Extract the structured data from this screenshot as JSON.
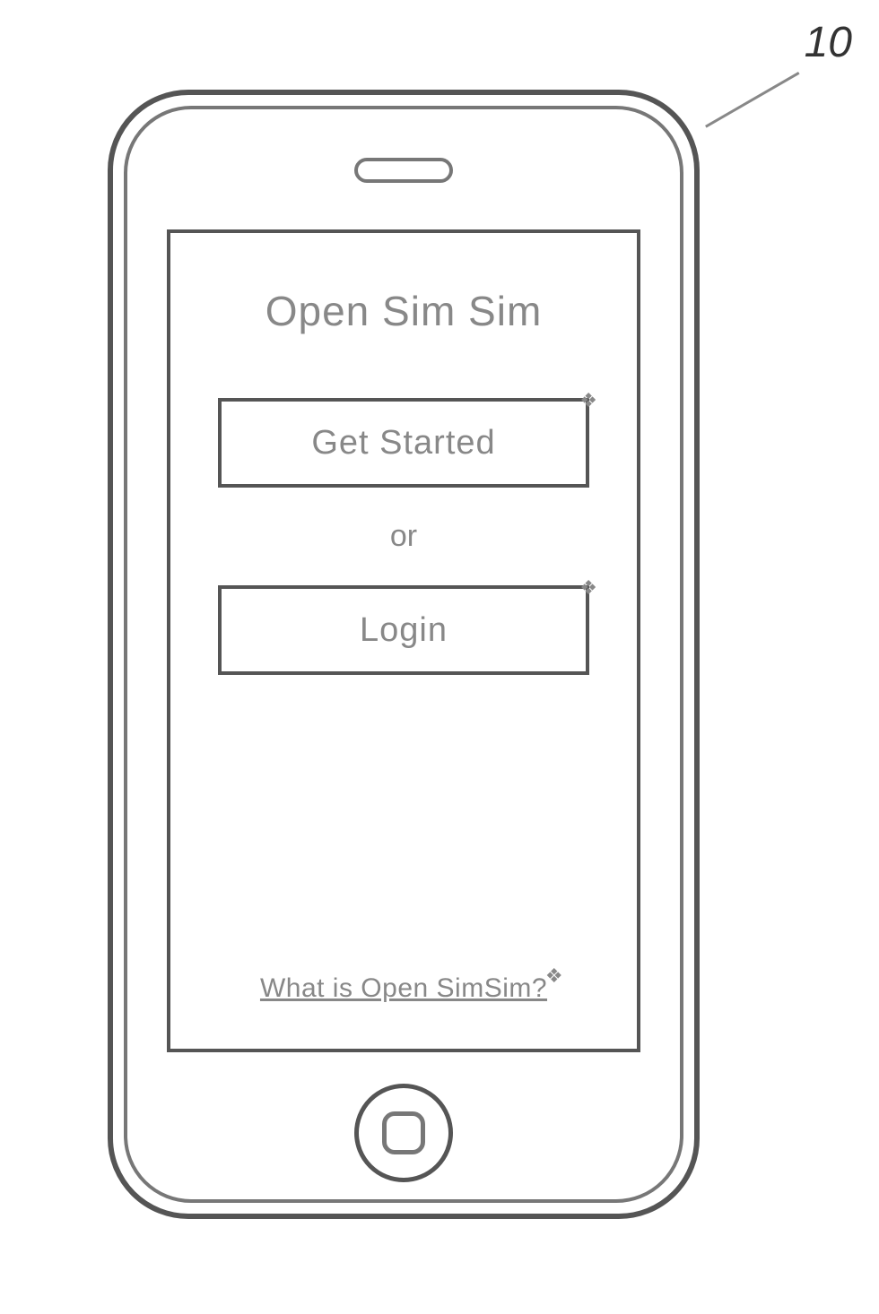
{
  "callout": {
    "label": "10"
  },
  "screen": {
    "title": "Open Sim Sim",
    "get_started_label": "Get Started",
    "divider": "or",
    "login_label": "Login",
    "help_link": "What is Open SimSim?"
  }
}
